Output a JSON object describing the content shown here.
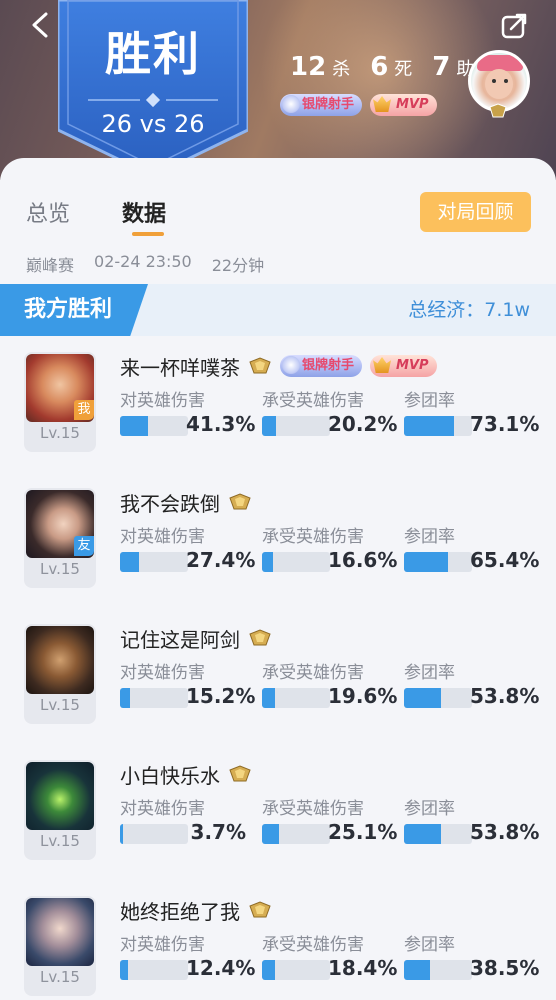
{
  "header": {
    "result_title": "胜利",
    "score": "26 vs 26",
    "kills": "12",
    "kills_label": "杀",
    "deaths": "6",
    "deaths_label": "死",
    "assists": "7",
    "assists_label": "助",
    "badge_silver": "银牌射手",
    "badge_mvp": "MVP",
    "icons": {
      "back": "back-arrow-icon",
      "share": "share-icon"
    }
  },
  "tabs": [
    {
      "label": "总览",
      "active": false
    },
    {
      "label": "数据",
      "active": true
    }
  ],
  "review_button": "对局回顾",
  "match": {
    "mode": "巅峰赛",
    "datetime": "02-24 23:50",
    "duration": "22分钟"
  },
  "team": {
    "result": "我方胜利",
    "economy": "总经济：7.1w"
  },
  "stat_labels": {
    "damage": "对英雄伤害",
    "taken": "承受英雄伤害",
    "participation": "参团率"
  },
  "players": [
    {
      "name": "来一杯咩噗茶",
      "level": "Lv.15",
      "tag": "我",
      "damage": "41.3%",
      "taken": "20.2%",
      "participation": "73.1%",
      "damage_frac": 0.413,
      "taken_frac": 0.202,
      "part_frac": 0.731,
      "badges": [
        "银牌射手",
        "MVP"
      ]
    },
    {
      "name": "我不会跌倒",
      "level": "Lv.15",
      "tag": "友",
      "damage": "27.4%",
      "taken": "16.6%",
      "participation": "65.4%",
      "damage_frac": 0.274,
      "taken_frac": 0.166,
      "part_frac": 0.654,
      "badges": []
    },
    {
      "name": "记住这是阿剑",
      "level": "Lv.15",
      "tag": "",
      "damage": "15.2%",
      "taken": "19.6%",
      "participation": "53.8%",
      "damage_frac": 0.152,
      "taken_frac": 0.196,
      "part_frac": 0.538,
      "badges": []
    },
    {
      "name": "小白快乐水",
      "level": "Lv.15",
      "tag": "",
      "damage": "3.7%",
      "taken": "25.1%",
      "participation": "53.8%",
      "damage_frac": 0.037,
      "taken_frac": 0.251,
      "part_frac": 0.538,
      "badges": []
    },
    {
      "name": "她终拒绝了我",
      "level": "Lv.15",
      "tag": "",
      "damage": "12.4%",
      "taken": "18.4%",
      "participation": "38.5%",
      "damage_frac": 0.124,
      "taken_frac": 0.184,
      "part_frac": 0.385,
      "badges": []
    }
  ],
  "colors": {
    "accent_blue": "#3a9ae6",
    "orange": "#fcc05c"
  }
}
